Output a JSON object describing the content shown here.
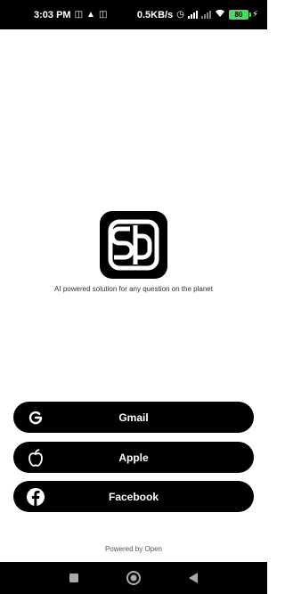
{
  "status_bar": {
    "time": "3:03 PM",
    "network_speed": "0.5KB/s",
    "battery": "80"
  },
  "logo": {
    "icon": "app-logo-icon"
  },
  "tagline": "AI powered solution for any question on the planet",
  "auth_buttons": {
    "gmail": {
      "label": "Gmail",
      "icon": "google-icon"
    },
    "apple": {
      "label": "Apple",
      "icon": "apple-icon"
    },
    "facebook": {
      "label": "Facebook",
      "icon": "facebook-icon"
    }
  },
  "footer": {
    "powered_by": "Powered by Open"
  },
  "colors": {
    "button_bg": "#000000",
    "button_text": "#ffffff",
    "background": "#ffffff"
  }
}
